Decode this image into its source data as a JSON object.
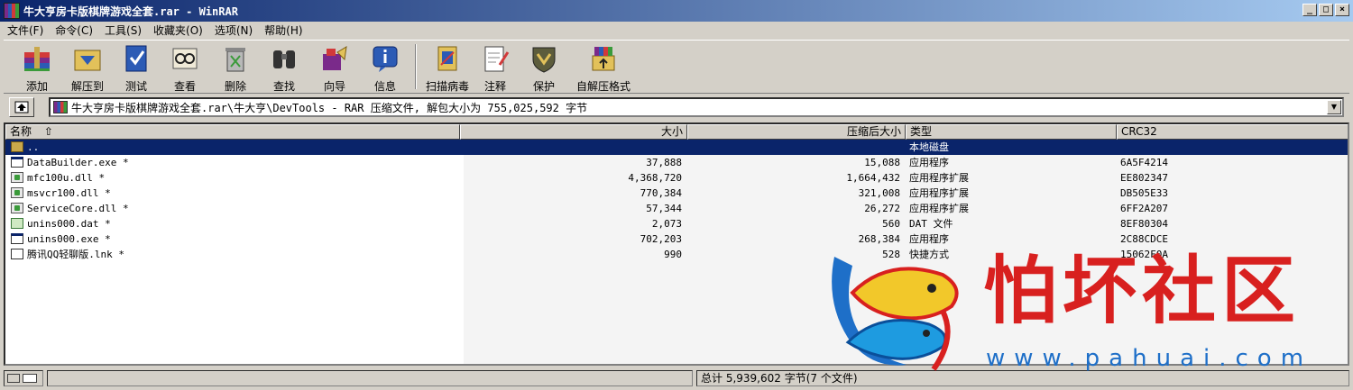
{
  "window": {
    "title": "牛大亨房卡版棋牌游戏全套.rar - WinRAR",
    "minimize": "_",
    "maximize": "□",
    "close": "×"
  },
  "menu": [
    "文件(F)",
    "命令(C)",
    "工具(S)",
    "收藏夹(O)",
    "选项(N)",
    "帮助(H)"
  ],
  "toolbar": {
    "add": "添加",
    "extract": "解压到",
    "test": "测试",
    "view": "查看",
    "delete": "删除",
    "find": "查找",
    "wizard": "向导",
    "info": "信息",
    "virus_scan": "扫描病毒",
    "comment": "注释",
    "protect": "保护",
    "sfx": "自解压格式"
  },
  "address": {
    "path": "牛大亨房卡版棋牌游戏全套.rar\\牛大亨\\DevTools - RAR 压缩文件, 解包大小为 755,025,592 字节"
  },
  "columns": {
    "name": "名称",
    "size": "大小",
    "packed": "压缩后大小",
    "type": "类型",
    "crc": "CRC32"
  },
  "files": [
    {
      "name": "..",
      "size": "",
      "packed": "",
      "type": "本地磁盘",
      "crc": "",
      "icon": "folder"
    },
    {
      "name": "DataBuilder.exe *",
      "size": "37,888",
      "packed": "15,088",
      "type": "应用程序",
      "crc": "6A5F4214",
      "icon": "exe"
    },
    {
      "name": "mfc100u.dll *",
      "size": "4,368,720",
      "packed": "1,664,432",
      "type": "应用程序扩展",
      "crc": "EE802347",
      "icon": "dll"
    },
    {
      "name": "msvcr100.dll *",
      "size": "770,384",
      "packed": "321,008",
      "type": "应用程序扩展",
      "crc": "DB505E33",
      "icon": "dll"
    },
    {
      "name": "ServiceCore.dll *",
      "size": "57,344",
      "packed": "26,272",
      "type": "应用程序扩展",
      "crc": "6FF2A207",
      "icon": "dll"
    },
    {
      "name": "unins000.dat *",
      "size": "2,073",
      "packed": "560",
      "type": "DAT 文件",
      "crc": "8EF80304",
      "icon": "dat"
    },
    {
      "name": "unins000.exe *",
      "size": "702,203",
      "packed": "268,384",
      "type": "应用程序",
      "crc": "2C88CDCE",
      "icon": "exe"
    },
    {
      "name": "腾讯QQ轻聊版.lnk *",
      "size": "990",
      "packed": "528",
      "type": "快捷方式",
      "crc": "15062F0A",
      "icon": "lnk"
    }
  ],
  "status": {
    "total": "总计 5,939,602 字节(7 个文件)"
  },
  "watermark": {
    "brand": "怕坏社区",
    "url": "www.pahuai.com"
  },
  "colors": {
    "titlebar_start": "#0a246a",
    "titlebar_end": "#a6caf0",
    "selection": "#0a246a",
    "watermark_red": "#d8201f",
    "watermark_blue": "#1e6fc8"
  }
}
